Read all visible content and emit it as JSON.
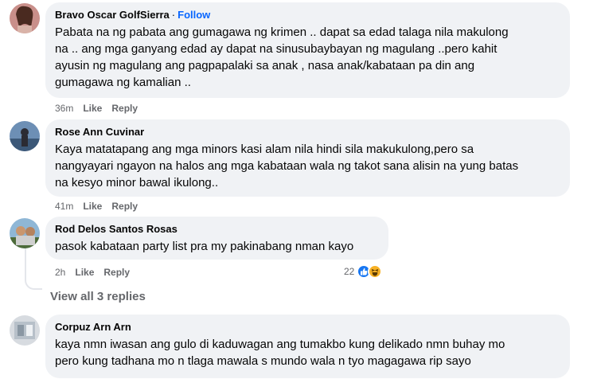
{
  "comments": [
    {
      "author": "Bravo Oscar GolfSierra",
      "separator": "·",
      "follow_label": "Follow",
      "lines": [
        "Pabata na ng pabata ang gumagawa ng krimen .. dapat sa edad talaga nila makulong",
        "na .. ang mga ganyang edad ay dapat na sinusubaybayan ng magulang ..pero kahit",
        "ayusin ng magulang ang pagpapalaki sa anak , nasa anak/kabataan pa din ang",
        "gumagawa ng kamalian .."
      ],
      "time": "36m",
      "like_label": "Like",
      "reply_label": "Reply"
    },
    {
      "author": "Rose Ann Cuvinar",
      "lines": [
        "Kaya matatapang ang mga minors kasi alam nila hindi sila makukulong,pero sa",
        "nangyayari ngayon na halos ang mga kabataan wala ng takot sana alisin na yung batas",
        "na kesyo minor bawal ikulong.."
      ],
      "time": "41m",
      "like_label": "Like",
      "reply_label": "Reply"
    },
    {
      "author": "Rod Delos Santos Rosas",
      "lines": [
        "pasok kabataan party list pra my pakinabang nman kayo"
      ],
      "time": "2h",
      "like_label": "Like",
      "reply_label": "Reply",
      "reaction_count": "22",
      "reaction_icons": [
        "like-icon",
        "haha-icon"
      ]
    },
    {
      "author": "Corpuz Arn Arn",
      "lines": [
        "kaya nmn iwasan ang gulo di kaduwagan ang tumakbo kung delikado nmn buhay mo",
        "pero kung tadhana mo n tlaga mawala s mundo wala n tyo magagawa rip sayo"
      ]
    }
  ],
  "view_replies_label": "View all 3 replies",
  "colors": {
    "bubble": "#f0f2f5",
    "follow": "#0866ff",
    "meta": "#65676b",
    "like": "#1877f2",
    "haha": "#f7b125"
  }
}
